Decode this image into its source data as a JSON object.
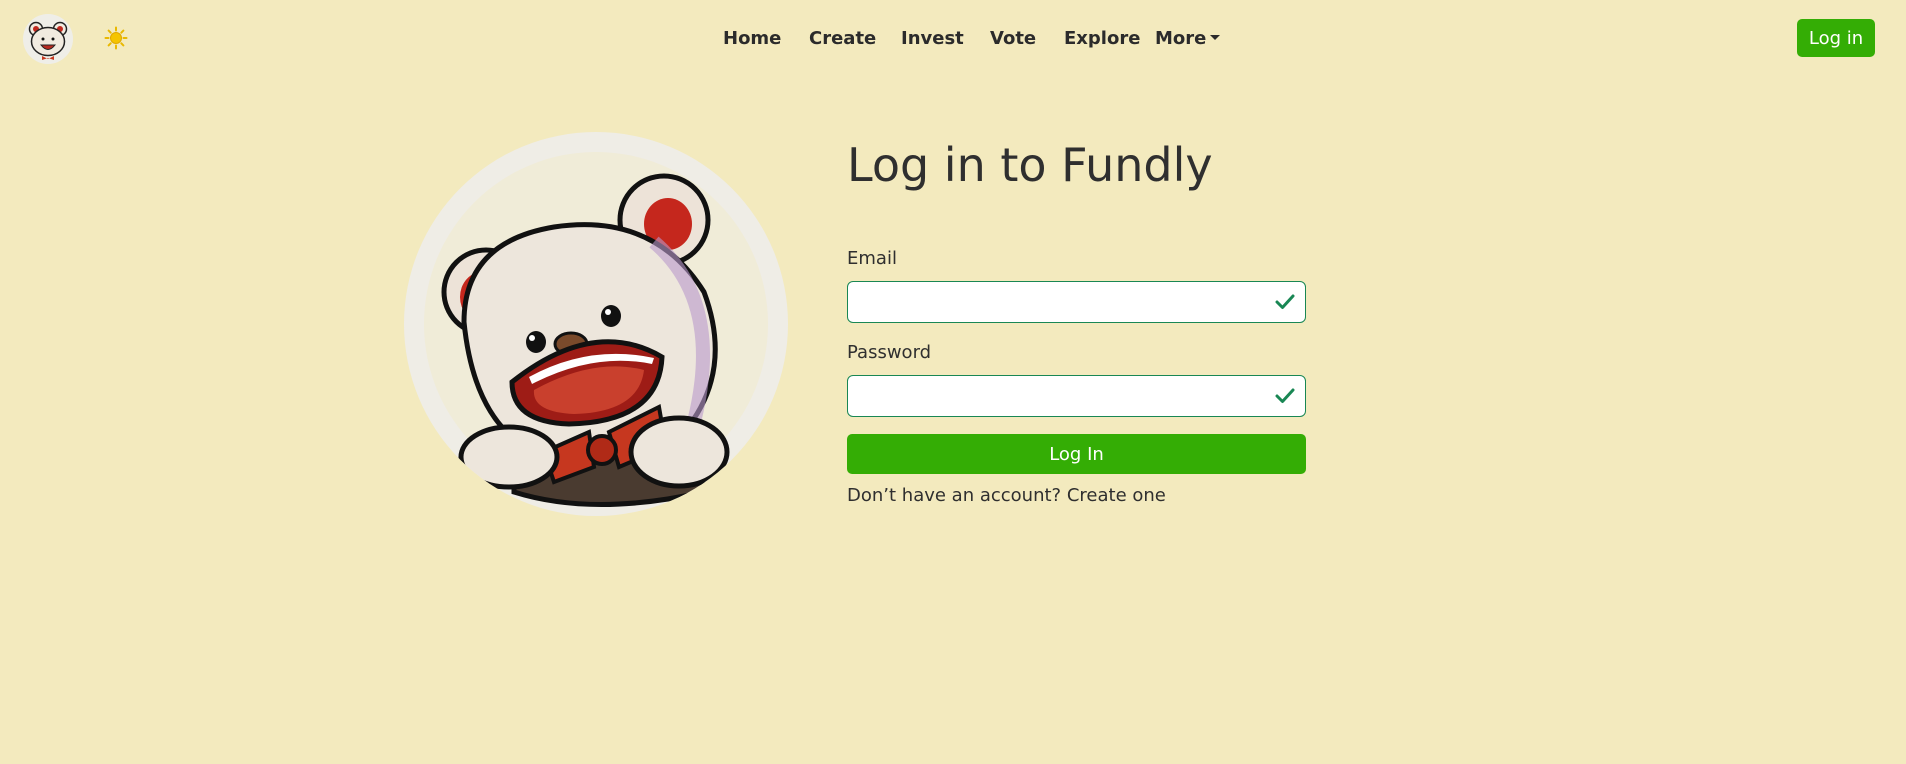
{
  "nav": {
    "links": [
      "Home",
      "Create",
      "Invest",
      "Vote",
      "Explore"
    ],
    "more_label": "More",
    "login_button": "Log in"
  },
  "icons": {
    "logo": "bear-logo-icon",
    "theme_toggle": "sun-icon",
    "field_valid": "check-icon",
    "dropdown": "caret-down-icon"
  },
  "colors": {
    "background": "#f3eabe",
    "accent": "#34ad05",
    "valid_border": "#198754"
  },
  "login": {
    "title": "Log in to Fundly",
    "email_label": "Email",
    "email_value": "",
    "password_label": "Password",
    "password_value": "",
    "submit_label": "Log In",
    "signup_prompt": "Don’t have an account?",
    "signup_link": "Create one"
  }
}
